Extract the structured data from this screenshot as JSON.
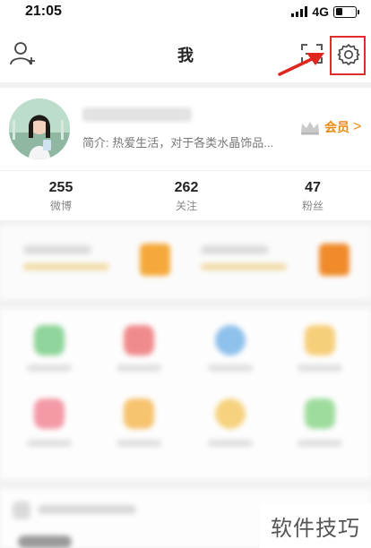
{
  "status_bar": {
    "time": "21:05",
    "network": "4G",
    "battery_level": 0.35
  },
  "nav": {
    "title": "我"
  },
  "profile": {
    "intro": "简介: 热爱生活，对于各类水晶饰品...",
    "vip_label": "会员",
    "vip_arrow": ">"
  },
  "stats": [
    {
      "value": "255",
      "label": "微博"
    },
    {
      "value": "262",
      "label": "关注"
    },
    {
      "value": "47",
      "label": "粉丝"
    }
  ],
  "watermark": {
    "text": "软件技巧"
  },
  "colors": {
    "accent": "#ea8a12",
    "highlight": "#e12c2c",
    "arrow": "#e0261f"
  },
  "icons": {
    "add_friend": "add-friend-icon",
    "scan": "scan-icon",
    "settings": "gear-icon",
    "crown": "crown-icon"
  }
}
